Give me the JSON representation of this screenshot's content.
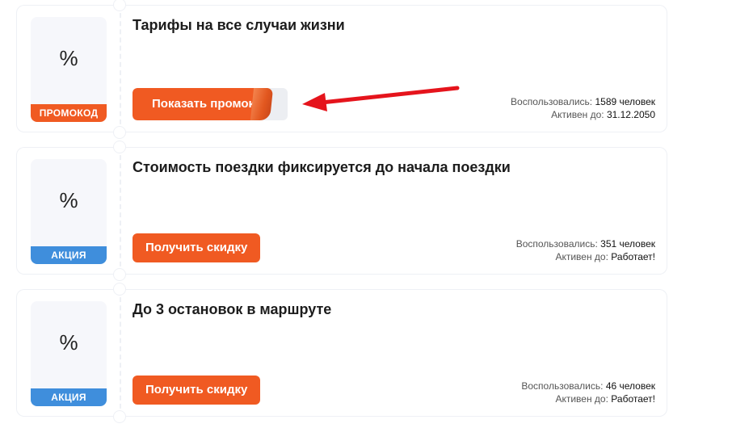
{
  "offers": [
    {
      "logo_symbol": "%",
      "badge": "ПРОМОКОД",
      "title": "Тарифы на все случаи жизни",
      "button_label": "Показать промокод",
      "used_label": "Воспользовались:",
      "used_value": "1589 человек",
      "active_label": "Активен до:",
      "active_value": "31.12.2050"
    },
    {
      "logo_symbol": "%",
      "badge": "АКЦИЯ",
      "title": "Стоимость поездки фиксируется до начала поездки",
      "button_label": "Получить скидку",
      "used_label": "Воспользовались:",
      "used_value": "351 человек",
      "active_label": "Активен до:",
      "active_value": "Работает!"
    },
    {
      "logo_symbol": "%",
      "badge": "АКЦИЯ",
      "title": "До 3 остановок в маршруте",
      "button_label": "Получить скидку",
      "used_label": "Воспользовались:",
      "used_value": "46 человек",
      "active_label": "Активен до:",
      "active_value": "Работает!"
    }
  ],
  "colors": {
    "accent": "#f05a22",
    "promo_badge": "#f05a22",
    "action_badge": "#3f8edc",
    "arrow": "#e5141c"
  }
}
